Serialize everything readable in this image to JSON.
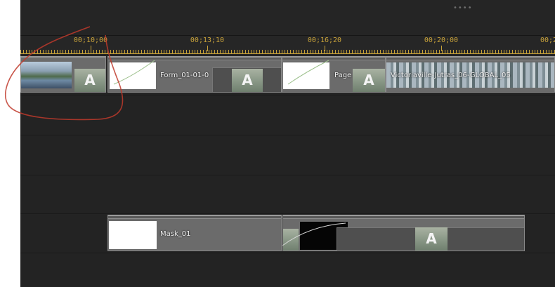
{
  "timeline": {
    "grip": "••••",
    "ruler": {
      "labels": [
        "00;10;00",
        "00;13;10",
        "00;16;20",
        "00;20;00",
        "00;2"
      ]
    },
    "clips": {
      "top_clip_1_label": "Form_01-01-0",
      "top_clip_2_label": "Page",
      "top_clip_3_label": "Victoriaville-Jutras_06-GLOBAL_05",
      "mask_clip_label": "Mask_01",
      "thumb_glyph": "A"
    }
  },
  "colors": {
    "ruler_accent": "#c8a23a",
    "annotation": "#c0392b"
  }
}
